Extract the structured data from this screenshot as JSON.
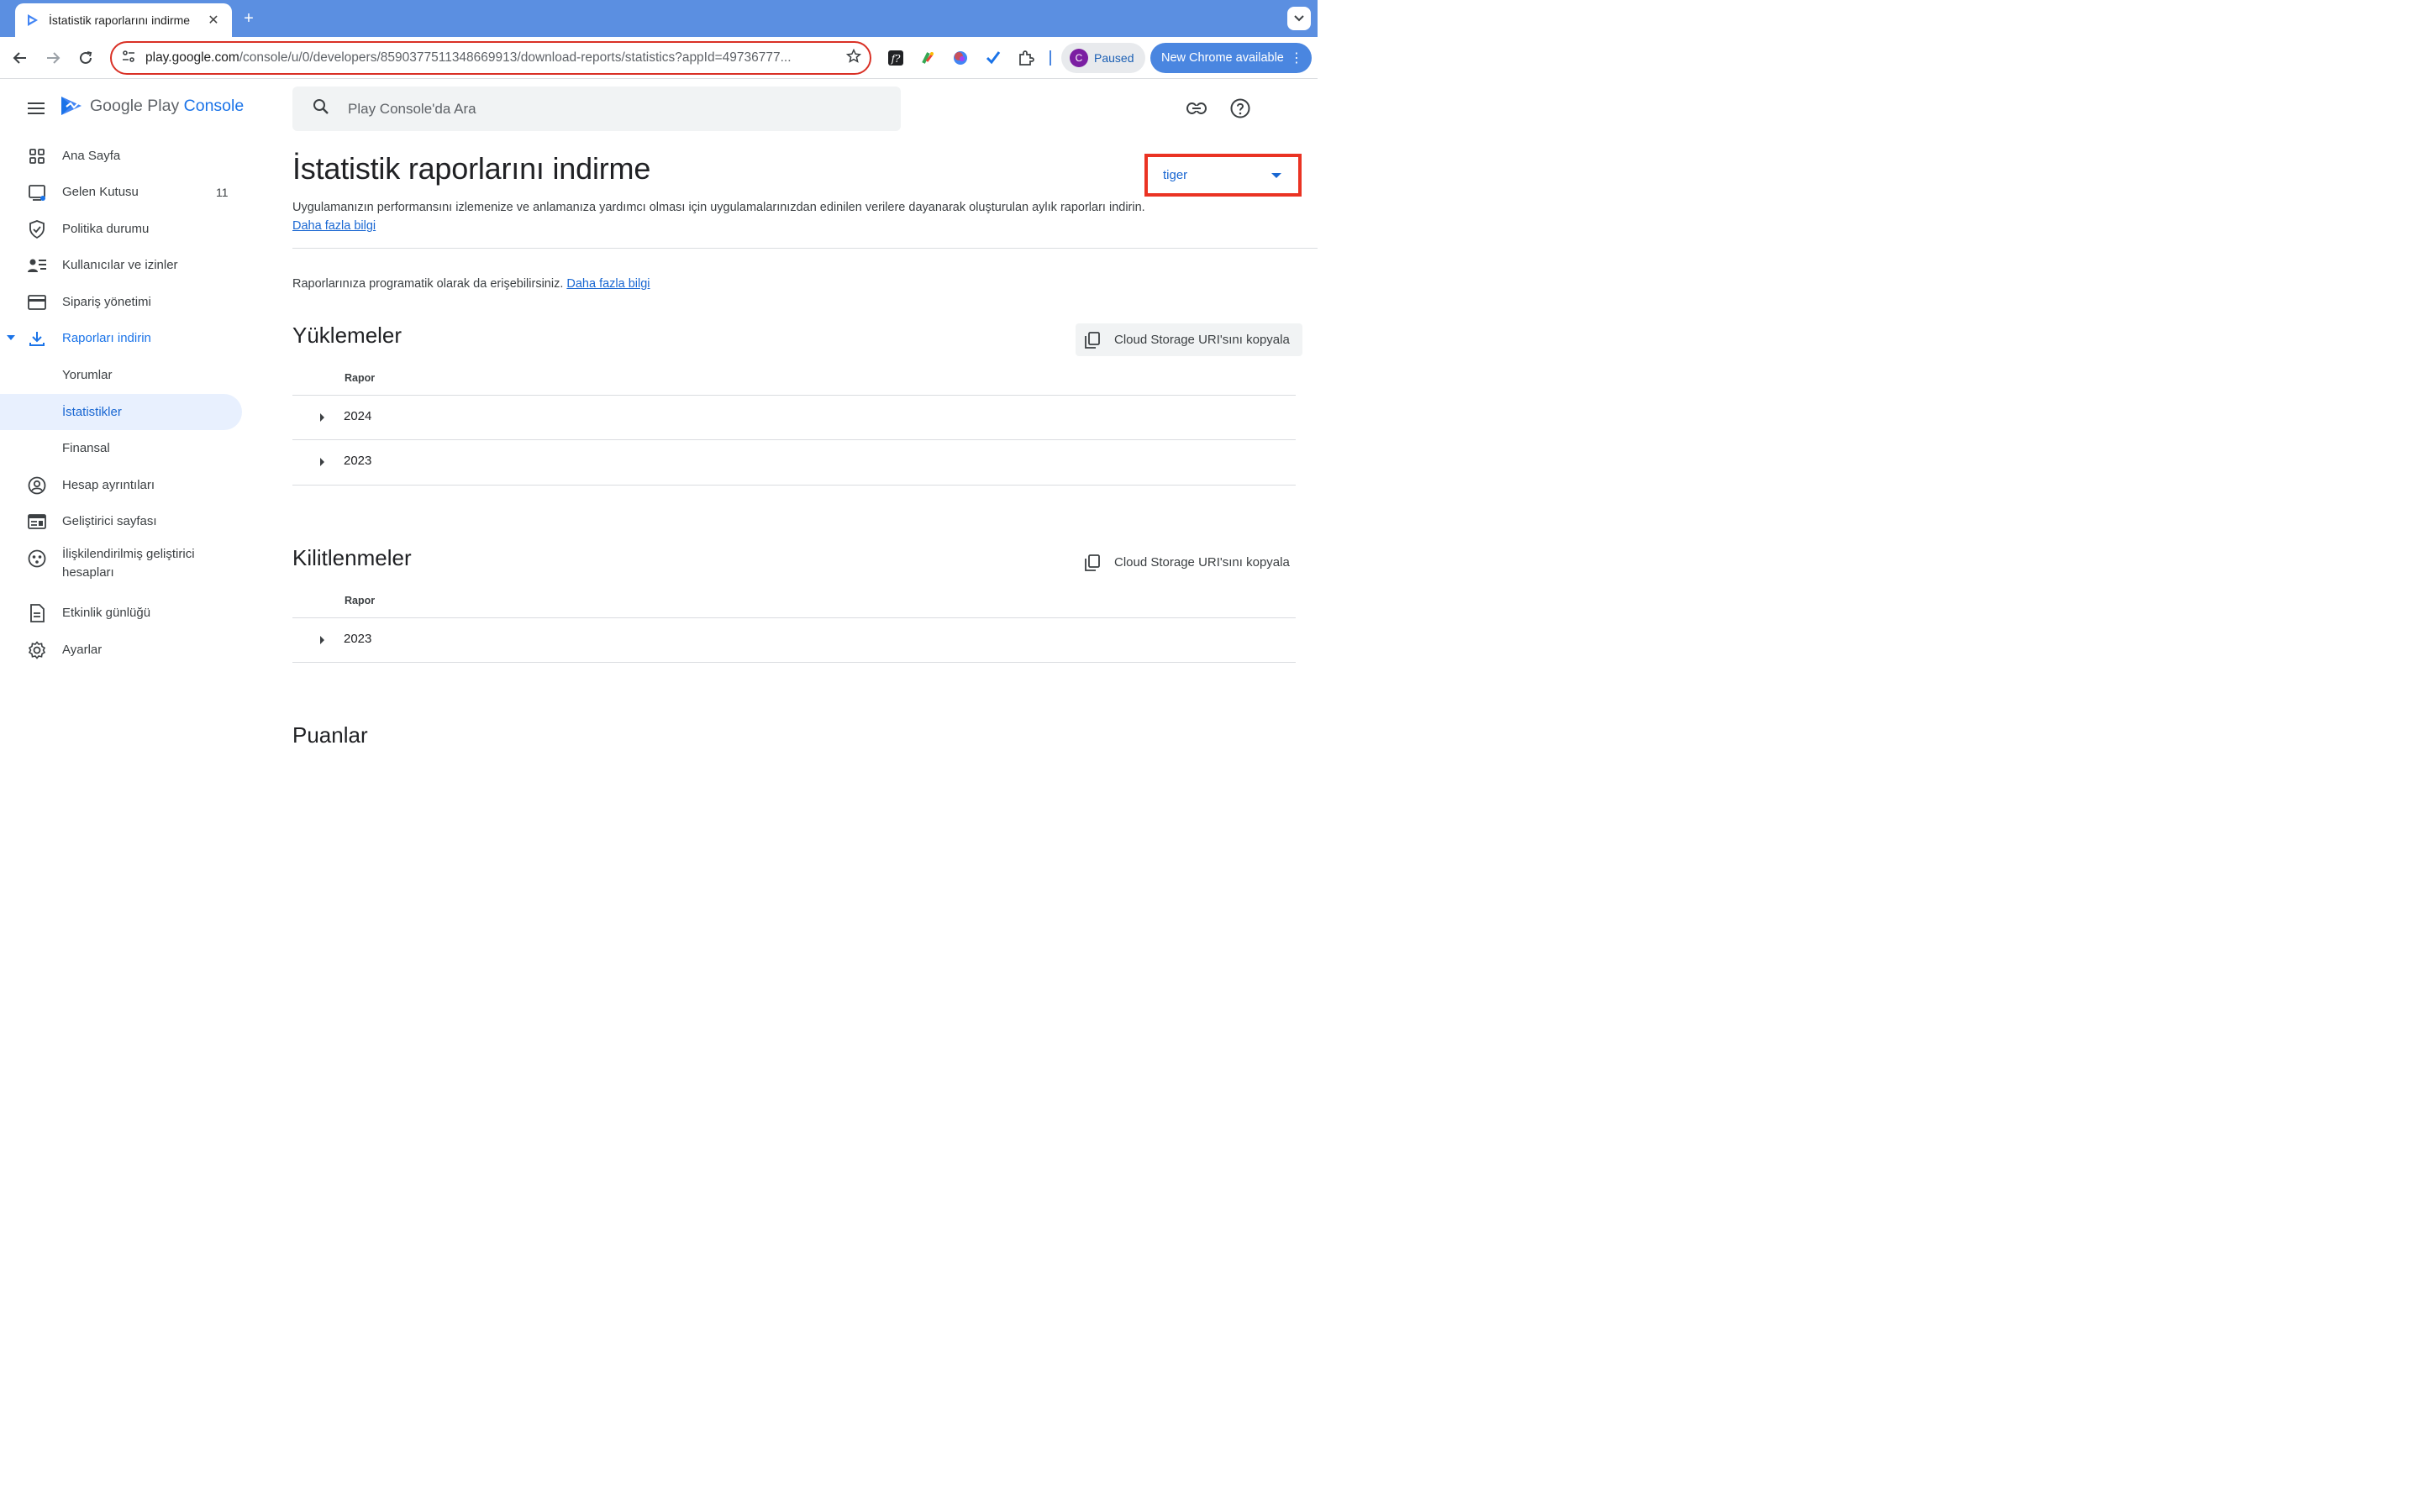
{
  "browser": {
    "tab_title": "İstatistik raporlarını indirme",
    "url_host": "play.google.com",
    "url_path": "/console/u/0/developers/8590377511348669913/download-reports/statistics?appId=49736777...",
    "profile_initial": "C",
    "profile_status": "Paused",
    "update_label": "New Chrome available"
  },
  "sidebar": {
    "logo_google_play": "Google Play",
    "logo_console": "Console",
    "items": [
      {
        "label": "Ana Sayfa",
        "icon": "dashboard-icon"
      },
      {
        "label": "Gelen Kutusu",
        "icon": "inbox-icon",
        "badge": "11"
      },
      {
        "label": "Politika durumu",
        "icon": "shield-check-icon"
      },
      {
        "label": "Kullanıcılar ve izinler",
        "icon": "users-permissions-icon"
      },
      {
        "label": "Sipariş yönetimi",
        "icon": "credit-card-icon"
      },
      {
        "label": "Raporları indirin",
        "icon": "download-icon"
      },
      {
        "label": "Yorumlar"
      },
      {
        "label": "İstatistikler"
      },
      {
        "label": "Finansal"
      },
      {
        "label": "Hesap ayrıntıları",
        "icon": "account-circle-icon"
      },
      {
        "label": "Geliştirici sayfası",
        "icon": "developer-page-icon"
      },
      {
        "label": "İlişkilendirilmiş geliştirici hesapları",
        "icon": "linked-accounts-icon"
      },
      {
        "label": "Etkinlik günlüğü",
        "icon": "activity-log-icon"
      },
      {
        "label": "Ayarlar",
        "icon": "settings-gear-icon"
      }
    ]
  },
  "search": {
    "placeholder": "Play Console'da Ara"
  },
  "page": {
    "title": "İstatistik raporlarını indirme",
    "app_selector": "tiger",
    "description": "Uygulamanızın performansını izlemenize ve anlamanıza yardımcı olması için uygulamalarınızdan edinilen verilere dayanarak oluşturulan aylık raporları indirin.",
    "learn_more": "Daha fazla bilgi",
    "programmatic_text": "Raporlarınıza programatik olarak da erişebilirsiniz.",
    "programmatic_link": "Daha fazla bilgi"
  },
  "sections": [
    {
      "title": "Yüklemeler",
      "copy_label": "Cloud Storage URI'sını kopyala",
      "column": "Rapor",
      "rows": [
        "2024",
        "2023"
      ]
    },
    {
      "title": "Kilitlenmeler",
      "copy_label": "Cloud Storage URI'sını kopyala",
      "column": "Rapor",
      "rows": [
        "2023"
      ]
    },
    {
      "title": "Puanlar"
    }
  ],
  "colors": {
    "accent": "#1a73e8",
    "highlight_border": "#ea3323",
    "selected_bg": "#e8f0fe",
    "chrome_blue": "#5b8fe1"
  }
}
